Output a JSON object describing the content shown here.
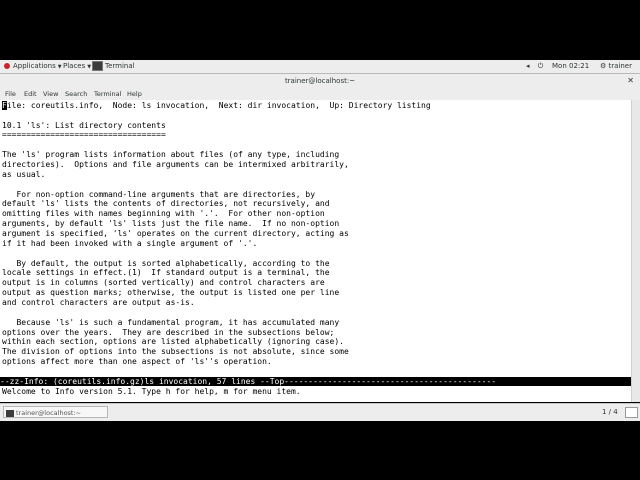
{
  "topbar": {
    "applications": "Applications",
    "places": "Places",
    "task": "Terminal",
    "clock": "Mon 02:21",
    "user": "trainer"
  },
  "window": {
    "title": "trainer@localhost:~",
    "menu": [
      "File",
      "Edit",
      "View",
      "Search",
      "Terminal",
      "Help"
    ]
  },
  "terminal": {
    "cursor_char": "F",
    "lines": [
      "ile: coreutils.info,  Node: ls invocation,  Next: dir invocation,  Up: Directory listing",
      "",
      "10.1 'ls': List directory contents",
      "==================================",
      "",
      "The 'ls' program lists information about files (of any type, including",
      "directories).  Options and file arguments can be intermixed arbitrarily,",
      "as usual.",
      "",
      "   For non-option command-line arguments that are directories, by",
      "default 'ls' lists the contents of directories, not recursively, and",
      "omitting files with names beginning with '.'.  For other non-option",
      "arguments, by default 'ls' lists just the file name.  If no non-option",
      "argument is specified, 'ls' operates on the current directory, acting as",
      "if it had been invoked with a single argument of '.'.",
      "",
      "   By default, the output is sorted alphabetically, according to the",
      "locale settings in effect.(1)  If standard output is a terminal, the",
      "output is in columns (sorted vertically) and control characters are",
      "output as question marks; otherwise, the output is listed one per line",
      "and control characters are output as-is.",
      "",
      "   Because 'ls' is such a fundamental program, it has accumulated many",
      "options over the years.  They are described in the subsections below;",
      "within each section, options are listed alphabetically (ignoring case).",
      "The division of options into the subsections is not absolute, since some",
      "options affect more than one aspect of 'ls''s operation."
    ],
    "modeline": "--zz-Info: (coreutils.info.gz)ls invocation, 57 lines --Top--------------------------------------------",
    "echo": "Welcome to Info version 5.1. Type h for help, m for menu item."
  },
  "taskbar": {
    "task_label": "trainer@localhost:~",
    "workspace": "1 / 4"
  }
}
